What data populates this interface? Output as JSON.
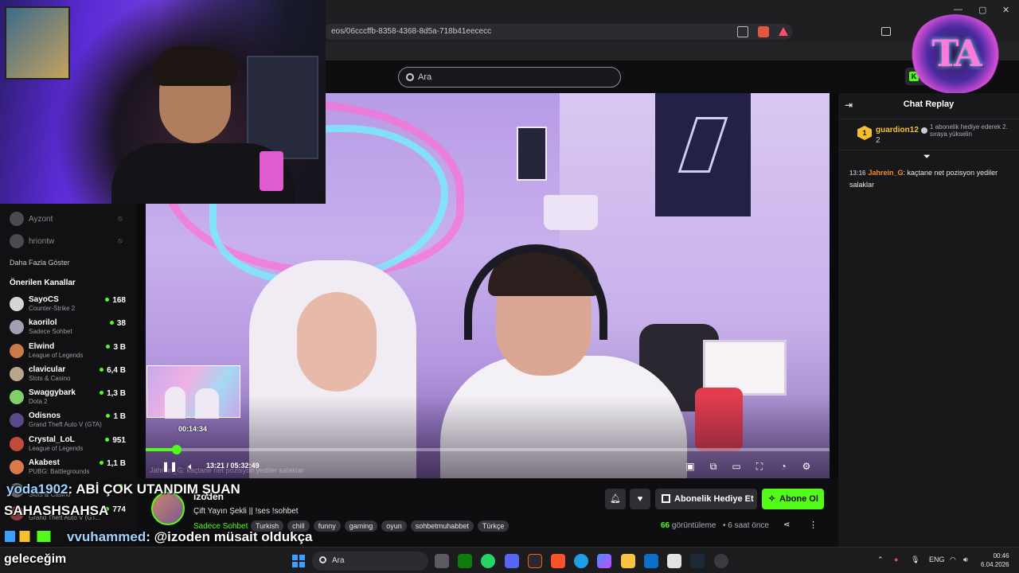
{
  "browser": {
    "url": "eos/06cccffb-8358-4368-8d5a-718b41eececc"
  },
  "header": {
    "search_placeholder": "Ara",
    "kick_label": "Ki"
  },
  "sidebar": {
    "followed": [
      {
        "name": "Ayzont"
      },
      {
        "name": "hriontw"
      }
    ],
    "show_more": "Daha Fazla Göster",
    "recommended_title": "Önerilen Kanallar",
    "recommended": [
      {
        "name": "SayoCS",
        "category": "Counter-Strike 2",
        "viewers": "168",
        "color": "#d6d6d6"
      },
      {
        "name": "kaorilol",
        "category": "Sadece Sohbet",
        "viewers": "38",
        "color": "#a0a0b0"
      },
      {
        "name": "Elwind",
        "category": "League of Legends",
        "viewers": "3 B",
        "color": "#c97a4a"
      },
      {
        "name": "clavicular",
        "category": "Slots & Casino",
        "viewers": "6,4 B",
        "color": "#b8a58a"
      },
      {
        "name": "Swaggybark",
        "category": "Dota 2",
        "viewers": "1,3 B",
        "color": "#7fd06a"
      },
      {
        "name": "Odisnos",
        "category": "Grand Theft Auto V (GTA)",
        "viewers": "1 B",
        "color": "#5a4a8a"
      },
      {
        "name": "Crystal_LoL",
        "category": "League of Legends",
        "viewers": "951",
        "color": "#c24a3a"
      },
      {
        "name": "Akabest",
        "category": "PUBG: Battlegrounds",
        "viewers": "1,1 B",
        "color": "#d9784a"
      },
      {
        "name": "",
        "category": "Slots & Casino",
        "viewers": "",
        "color": "#6a6a70"
      },
      {
        "name": "",
        "category": "Grand Theft Auto V (GT...",
        "viewers": "774",
        "color": "#8a3a3a"
      }
    ]
  },
  "player": {
    "preview_time": "00:14:34",
    "time_current": "13:21",
    "time_sep": " / ",
    "time_total": "05:32:49",
    "progress": 0.0449,
    "chat_ghost": "Jahrein_G: kaçtane net pozisyon yediler salaklar"
  },
  "chat": {
    "title": "Chat Replay",
    "pinned": {
      "badge": "1",
      "user": "guardion12",
      "count": "2",
      "text": "1 abonelik hediye ederek 2. sıraya yükselin"
    },
    "messages": [
      {
        "time": "13:16",
        "user": "Jahrein_G",
        "text": "kaçtane net pozisyon yediler salaklar"
      }
    ]
  },
  "stream": {
    "streamer": "izoden",
    "title": "Çift Yayın Şekli || !ses !sohbet",
    "category": "Sadece Sohbet",
    "tags": [
      "Turkish",
      "chill",
      "funny",
      "gaming",
      "oyun",
      "sohbetmuhabbet",
      "Türkçe"
    ],
    "gift_label": "Abonelik Hediye Et",
    "subscribe_label": "Abone Ol",
    "views_count": "66",
    "views_label": "görüntüleme",
    "ago": "6 saat önce"
  },
  "overlay_chat": {
    "msg1_user": "yoda1902",
    "msg1_text": ": ABİ ÇOK UTANDIM ŞUAN",
    "msg2_text": "SAHASHSAHSA",
    "msg3_user": "vvuhammed",
    "msg3_text": ": @izoden müsait oldukça",
    "msg4_text": "geleceğim"
  },
  "logo": {
    "text": "TA"
  },
  "taskbar": {
    "search_placeholder": "Ara",
    "lang": "ENG",
    "time": "00:46",
    "date": "6.04.2026"
  },
  "colors": {
    "accent": "#53fc18",
    "background": "#0e0e10",
    "panel": "#18181b"
  }
}
